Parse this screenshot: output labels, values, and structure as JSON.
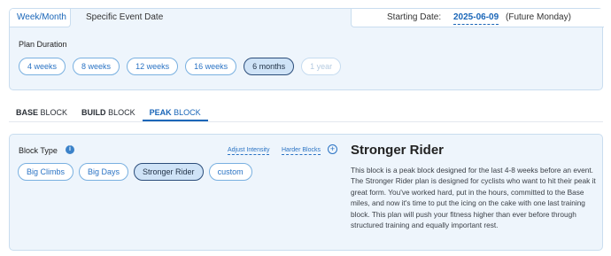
{
  "plan": {
    "mode_tabs": [
      "Week/Month",
      "Specific Event Date"
    ],
    "starting_date_label": "Starting Date:",
    "starting_date_value": "2025-06-09",
    "starting_date_note": "(Future Monday)",
    "duration_title": "Plan Duration",
    "durations": [
      "4 weeks",
      "8 weeks",
      "12 weeks",
      "16 weeks",
      "6 months",
      "1 year"
    ],
    "selected_duration": "6 months",
    "disabled_duration": "1 year"
  },
  "block_tabs": [
    {
      "name": "BASE",
      "suffix": "BLOCK"
    },
    {
      "name": "BUILD",
      "suffix": "BLOCK"
    },
    {
      "name": "PEAK",
      "suffix": "BLOCK"
    }
  ],
  "active_block_tab": "PEAK",
  "block": {
    "type_label": "Block Type",
    "info_icon": "i",
    "adjust_link": "Adjust Intensity",
    "harder_link": "Harder Blocks",
    "plus_icon": "+",
    "types": [
      "Big Climbs",
      "Big Days",
      "Stronger Rider",
      "custom"
    ],
    "selected_type": "Stronger Rider",
    "description_title": "Stronger Rider",
    "description": "This block is a peak block designed for the last 4-8 weeks before an event. The Stronger Rider plan is designed for cyclists who want to hit their peak it great form. You've worked hard, put in the hours, committed to the Base miles, and now it's time to put the icing on the cake with one last training block. This plan will push your fitness higher than ever before through structured training and equally important rest."
  },
  "colors": {
    "accent": "#1a66b8",
    "panel_bg": "#eef5fc",
    "panel_border": "#c9ddef",
    "selected_pill_bg": "#cfe3f7"
  }
}
